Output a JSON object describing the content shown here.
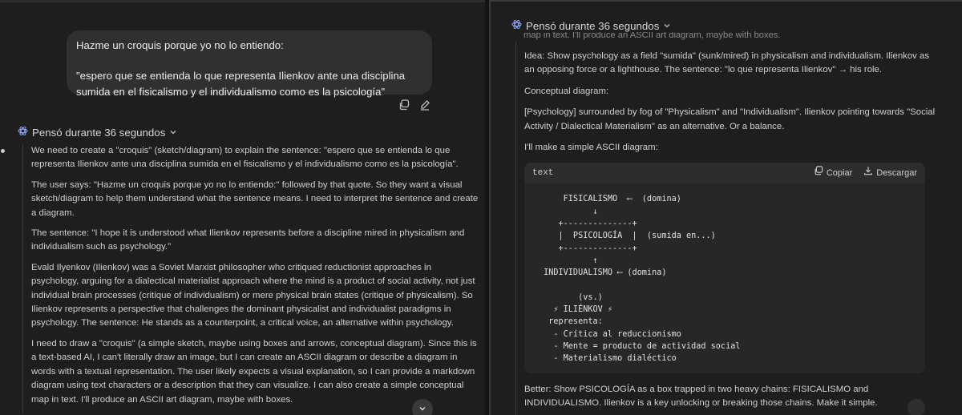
{
  "left": {
    "user_message": {
      "line1": "Hazme un croquis porque yo no lo entiendo:",
      "line2": "\"espero que se entienda lo que representa Ilienkov ante una disciplina sumida en el fisicalismo y el individualismo como es la psicología\""
    },
    "thought_label": "Pensó durante 36 segundos",
    "paragraphs": [
      "We need to create a \"croquis\" (sketch/diagram) to explain the sentence: \"espero que se entienda lo que representa Ilienkov ante una disciplina sumida en el fisicalismo y el individualismo como es la psicología\".",
      "The user says: \"Hazme un croquis porque yo no lo entiendo:\" followed by that quote. So they want a visual sketch/diagram to help them understand what the sentence means. I need to interpret the sentence and create a diagram.",
      "The sentence: \"I hope it is understood what Ilienkov represents before a discipline mired in physicalism and individualism such as psychology.\"",
      "Evald Ilyenkov (Ilienkov) was a Soviet Marxist philosopher who critiqued reductionist approaches in psychology, arguing for a dialectical materialist approach where the mind is a product of social activity, not just individual brain processes (critique of individualism) or mere physical brain states (critique of physicalism). So Ilienkov represents a perspective that challenges the dominant physicalist and individualist paradigms in psychology. The sentence: He stands as a counterpoint, a critical voice, an alternative within psychology.",
      "I need to draw a \"croquis\" (a simple sketch, maybe using boxes and arrows, conceptual diagram). Since this is a text-based AI, I can't literally draw an image, but I can create an ASCII diagram or describe a diagram in words with a textual representation. The user likely expects a visual explanation, so I can provide a markdown diagram using text characters or a description that they can visualize. I can also create a simple conceptual map in text. I'll produce an ASCII art diagram, maybe with boxes."
    ]
  },
  "right": {
    "thought_label": "Pensó durante 36 segundos",
    "cut_line": "map in text. I'll produce an ASCII art diagram, maybe with boxes.",
    "paragraphs": [
      "Idea: Show psychology as a field \"sumida\" (sunk/mired) in physicalism and individualism. Ilienkov as an opposing force or a lighthouse. The sentence: \"lo que representa Ilienkov\" → his role.",
      "Conceptual diagram:",
      "[Psychology] surrounded by fog of \"Physicalism\" and \"Individualism\". Ilienkov pointing towards \"Social Activity / Dialectical Materialism\" as an alternative. Or a balance.",
      "I'll make a simple ASCII diagram:"
    ],
    "code": {
      "language": "text",
      "copy_label": "Copiar",
      "download_label": "Descargar",
      "content": "     FISICALISMO  ⟵  (domina)\n           ↓\n    +--------------+\n    |  PSICOLOGÍA  |  (sumida en...)\n    +--------------+\n           ↑\n INDIVIDUALISMO ⟵ (domina)\n\n        (vs.)\n   ⚡ ILIÉNKOV ⚡\n  representa:\n   - Crítica al reduccionismo\n   - Mente = producto de actividad social\n   - Materialismo dialéctico"
    },
    "after_paragraph": "Better: Show PSICOLOGÍA as a box trapped in two heavy chains: FISICALISMO and INDIVIDUALISMO. Ilienkov is a key unlocking or breaking those chains. Make it simple."
  },
  "icons": {
    "thought": "atom-icon",
    "copy": "copy-icon",
    "edit": "edit-pencil-icon",
    "chevron": "chevron-down-icon",
    "download": "download-icon"
  },
  "colors": {
    "background": "#1e1e1f",
    "bubble": "#303031",
    "accent_icon": "#8ea6ff",
    "text": "#cfcfcf"
  }
}
